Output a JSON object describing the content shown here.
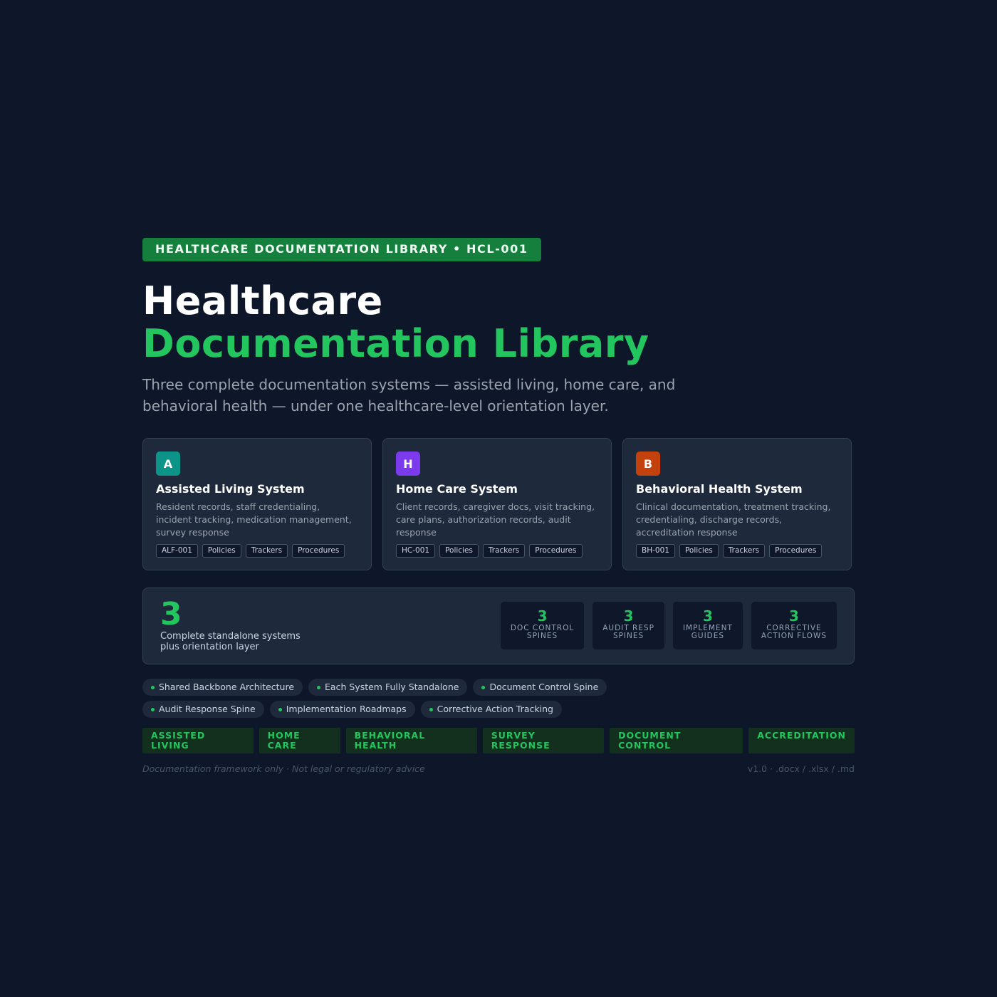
{
  "badge": "HEALTHCARE DOCUMENTATION LIBRARY • HCL-001",
  "title": {
    "line1": "Healthcare",
    "line2": "Documentation Library"
  },
  "subtitle": "Three complete documentation systems — assisted living, home care, and behavioral health — under one healthcare-level orientation layer.",
  "cards": [
    {
      "icon_letter": "A",
      "icon_color": "#0d9488",
      "title": "Assisted Living System",
      "description": "Resident records, staff credentialing, incident tracking, medication management, survey response",
      "tags": [
        "ALF-001",
        "Policies",
        "Trackers",
        "Procedures"
      ]
    },
    {
      "icon_letter": "H",
      "icon_color": "#7c3aed",
      "title": "Home Care System",
      "description": "Client records, caregiver docs, visit tracking, care plans, authorization records, audit response",
      "tags": [
        "HC-001",
        "Policies",
        "Trackers",
        "Procedures"
      ]
    },
    {
      "icon_letter": "B",
      "icon_color": "#c2410c",
      "title": "Behavioral Health System",
      "description": "Clinical documentation, treatment tracking, credentialing, discharge records, accreditation response",
      "tags": [
        "BH-001",
        "Policies",
        "Trackers",
        "Procedures"
      ]
    }
  ],
  "stats": {
    "big_number": "3",
    "caption_line1": "Complete standalone systems",
    "caption_line2": "plus orientation layer",
    "boxes": [
      {
        "value": "3",
        "label_line1": "DOC CONTROL",
        "label_line2": "SPINES"
      },
      {
        "value": "3",
        "label_line1": "AUDIT RESP",
        "label_line2": "SPINES"
      },
      {
        "value": "3",
        "label_line1": "IMPLEMENT",
        "label_line2": "GUIDES"
      },
      {
        "value": "3",
        "label_line1": "CORRECTIVE",
        "label_line2": "ACTION FLOWS"
      }
    ]
  },
  "features": [
    "Shared Backbone Architecture",
    "Each System Fully Standalone",
    "Document Control Spine",
    "Audit Response Spine",
    "Implementation Roadmaps",
    "Corrective Action Tracking"
  ],
  "categories": [
    "ASSISTED LIVING",
    "HOME CARE",
    "BEHAVIORAL HEALTH",
    "SURVEY RESPONSE",
    "DOCUMENT CONTROL",
    "ACCREDITATION"
  ],
  "footer": {
    "disclaimer": "Documentation framework only · Not legal or regulatory advice",
    "version": "v1.0 · .docx / .xlsx / .md"
  },
  "colors": {
    "background": "#0e1729",
    "accent_green": "#22c55e",
    "badge_green": "#15803d"
  }
}
